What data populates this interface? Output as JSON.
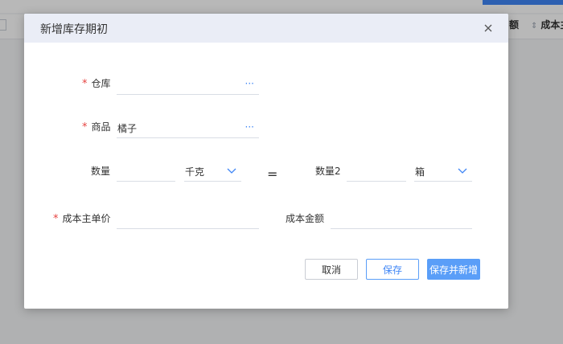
{
  "background": {
    "col_partial": "额",
    "col_right": "成本主"
  },
  "dialog": {
    "title": "新增库存期初",
    "fields": {
      "warehouse": {
        "required": "*",
        "label": "仓库",
        "value": "",
        "picker": "···"
      },
      "product": {
        "required": "*",
        "label": "商品",
        "value": "橘子",
        "picker": "···"
      },
      "qty": {
        "label": "数量",
        "value": "",
        "unit": "千克"
      },
      "equals": "=",
      "qty2": {
        "label": "数量2",
        "value": "",
        "unit": "箱"
      },
      "unit_cost": {
        "required": "*",
        "label": "成本主单价",
        "value": ""
      },
      "cost_amount": {
        "label": "成本金额",
        "value": ""
      }
    },
    "buttons": {
      "cancel": "取消",
      "save": "保存",
      "save_new": "保存并新增"
    }
  },
  "colors": {
    "accent": "#3f86f6",
    "required": "#e64340",
    "header_bg": "#eaedf6"
  },
  "icons": [
    "close-icon",
    "ellipsis-icon",
    "chevron-down-icon",
    "sort-icon"
  ]
}
